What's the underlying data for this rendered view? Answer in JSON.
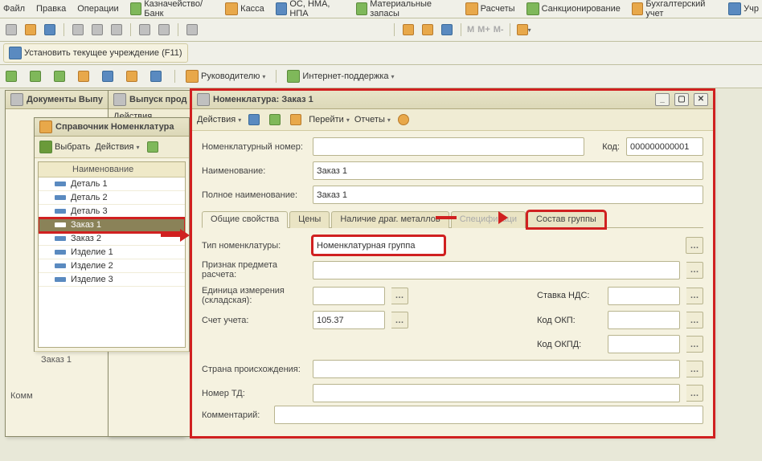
{
  "menu": {
    "file": "Файл",
    "edit": "Правка",
    "ops": "Операции",
    "treasury": "Казначейство/Банк",
    "cash": "Касса",
    "os": "ОС, НМА, НПА",
    "stock": "Материальные запасы",
    "calc": "Расчеты",
    "sanction": "Санкционирование",
    "acct": "Бухгалтерский учет",
    "uch": "Учр"
  },
  "toolbar2": {
    "set_inst": "Установить текущее учреждение (F11)"
  },
  "toolbar3": {
    "lead": "Руководителю",
    "support": "Интернет-поддержка"
  },
  "win_docs": {
    "title": "Документы Выпу"
  },
  "win_release": {
    "title": "Выпуск прод",
    "actions": "Действия"
  },
  "win_ref": {
    "title": "Справочник Номенклатура",
    "select": "Выбрать",
    "actions": "Действия",
    "header": "Наименование",
    "items": [
      "Деталь 1",
      "Деталь 2",
      "Деталь 3",
      "Заказ 1",
      "Заказ 2",
      "Изделие  1",
      "Изделие  2",
      "Изделие 3"
    ],
    "selected_index": 3,
    "status": "Заказ 1"
  },
  "win_nom": {
    "title": "Номенклатура:  Заказ 1",
    "actions": "Действия",
    "go": "Перейти",
    "reports": "Отчеты",
    "labels": {
      "num": "Номенклатурный номер:",
      "code": "Код:",
      "name": "Наименование:",
      "fullname": "Полное наименование:",
      "type": "Тип номенклатуры:",
      "calc_sign": "Признак предмета расчета:",
      "unit": "Единица измерения (складская):",
      "acct": "Счет учета:",
      "vat": "Ставка НДС:",
      "okp": "Код ОКП:",
      "okpd": "Код ОКПД:",
      "country": "Страна происхождения:",
      "td": "Номер ТД:",
      "comment": "Комментарий:"
    },
    "values": {
      "code": "000000000001",
      "name": "Заказ 1",
      "fullname": "Заказ 1",
      "type": "Номенклатурная группа",
      "acct": "105.37"
    },
    "tabs": [
      "Общие свойства",
      "Цены",
      "Наличие драг. металлов",
      "Спецификаци",
      "Состав группы"
    ],
    "active_tab": 0
  },
  "left_label": "Комм"
}
